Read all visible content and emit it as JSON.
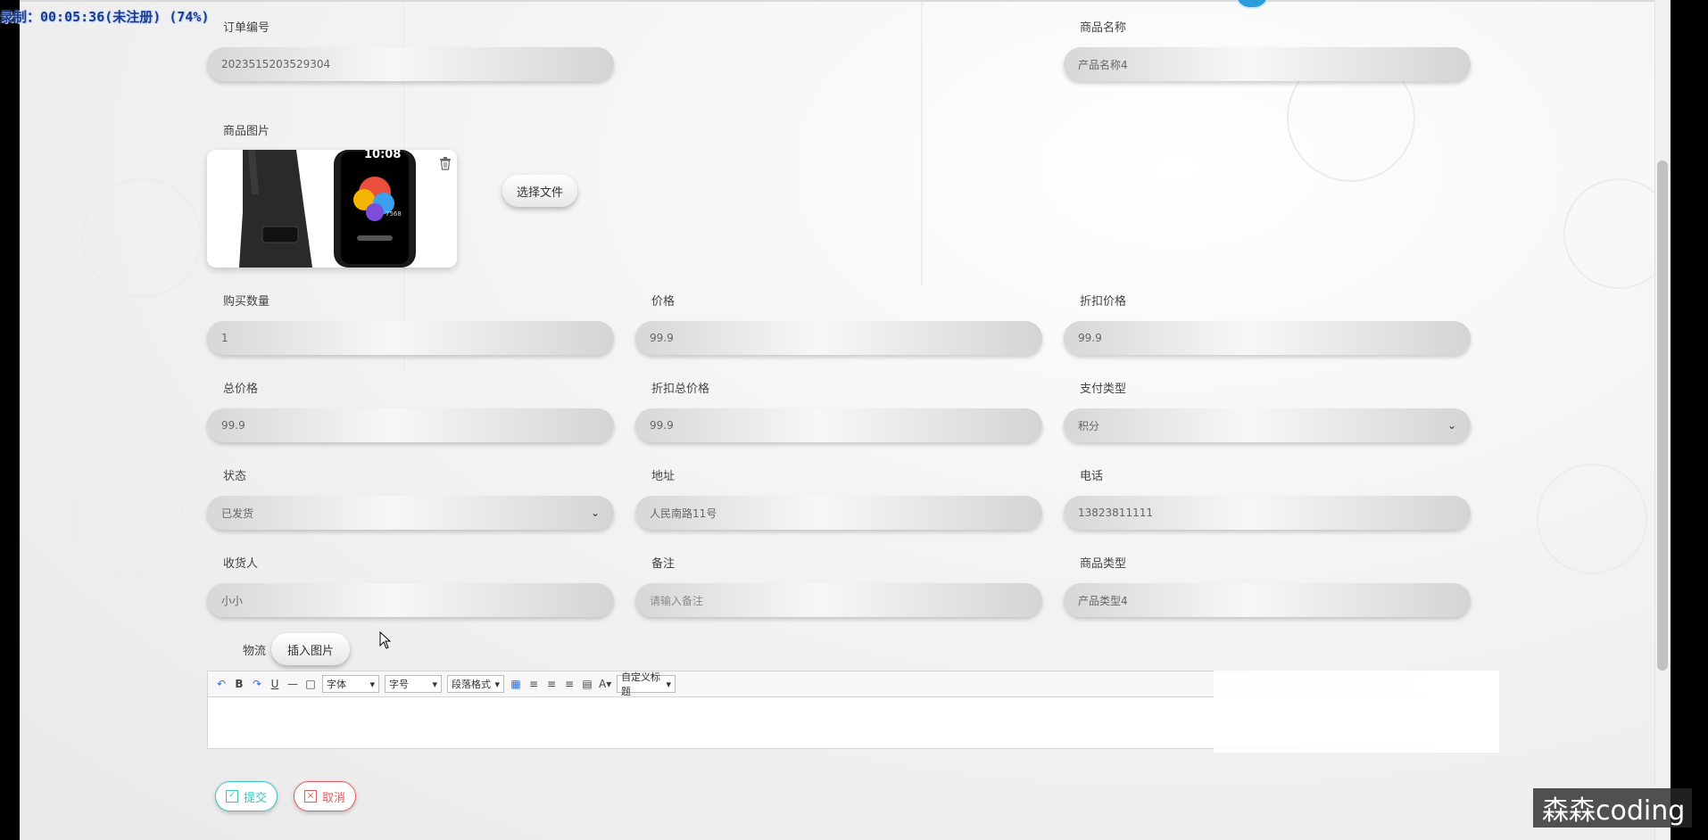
{
  "recording": "录制：00:05:36(未注册) (74%)",
  "form": {
    "order_no": {
      "label": "订单编号",
      "value": "2023515203529304"
    },
    "product_name": {
      "label": "商品名称",
      "value": "产品名称4"
    },
    "product_image": {
      "label": "商品图片",
      "choose_file": "选择文件",
      "watch_time": "10:08",
      "watch_steps": "7568"
    },
    "quantity": {
      "label": "购买数量",
      "value": "1"
    },
    "price": {
      "label": "价格",
      "value": "99.9"
    },
    "discount_price": {
      "label": "折扣价格",
      "value": "99.9"
    },
    "total_price": {
      "label": "总价格",
      "value": "99.9"
    },
    "discount_total": {
      "label": "折扣总价格",
      "value": "99.9"
    },
    "pay_type": {
      "label": "支付类型",
      "value": "积分"
    },
    "status": {
      "label": "状态",
      "value": "已发货"
    },
    "address": {
      "label": "地址",
      "value": "人民南路11号"
    },
    "phone": {
      "label": "电话",
      "value": "13823811111"
    },
    "receiver": {
      "label": "收货人",
      "value": "小小"
    },
    "remark": {
      "label": "备注",
      "placeholder": "请输入备注"
    },
    "product_type": {
      "label": "商品类型",
      "value": "产品类型4"
    },
    "logistics": {
      "label": "物流",
      "insert_image": "插入图片"
    }
  },
  "toolbar": {
    "bold": "B",
    "underline": "U",
    "font": "字体",
    "size": "字号",
    "paragraph": "段落格式",
    "fontcolor": "A",
    "custom_title": "自定义标题"
  },
  "actions": {
    "submit": "提交",
    "cancel": "取消"
  },
  "watermark": "森森coding",
  "colors": {
    "submit": "#3cc4c4",
    "cancel": "#e05c5c",
    "accent": "#2d9cdb"
  }
}
